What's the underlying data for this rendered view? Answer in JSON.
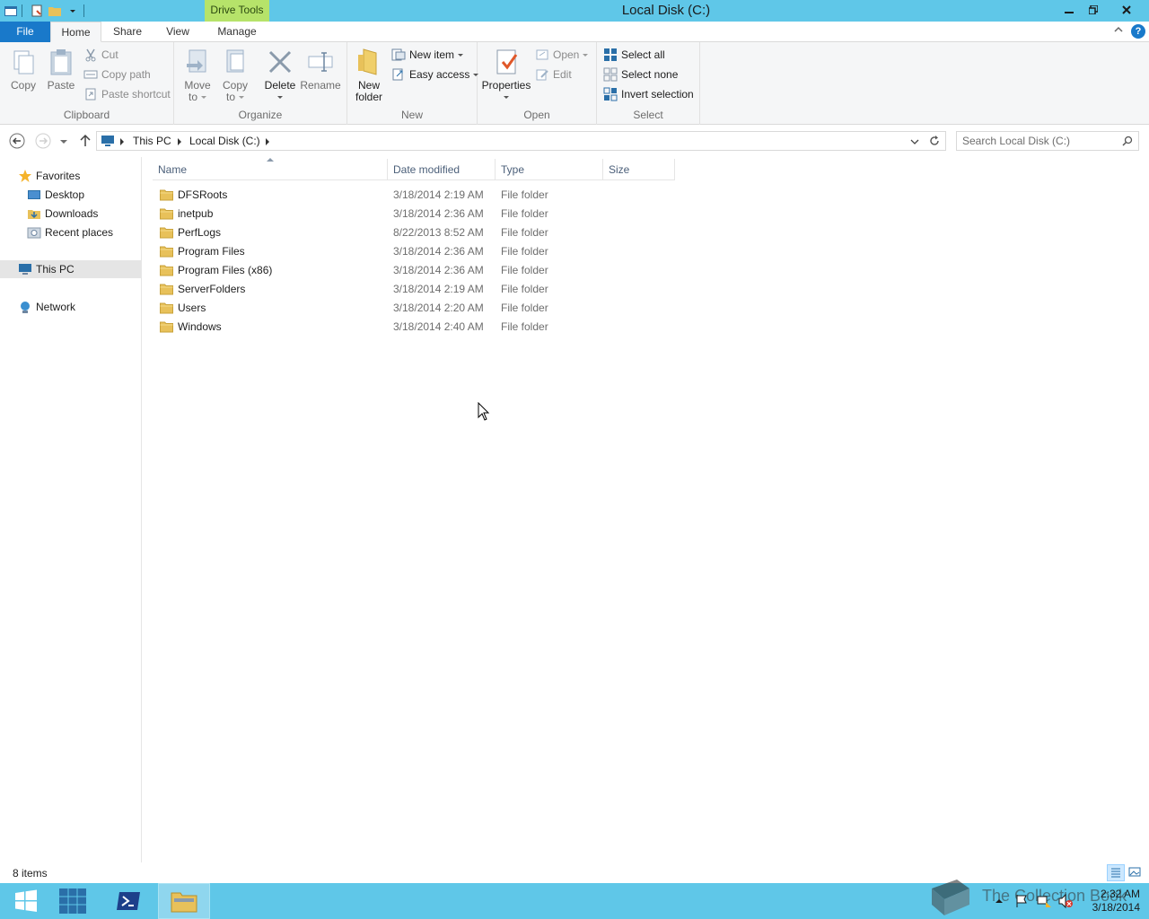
{
  "window": {
    "title": "Local Disk (C:)",
    "contextual_group": "Drive Tools"
  },
  "ribbon_tabs": {
    "file": "File",
    "home": "Home",
    "share": "Share",
    "view": "View",
    "manage": "Manage",
    "help": "?"
  },
  "ribbon": {
    "clipboard": {
      "label": "Clipboard",
      "copy": "Copy",
      "paste": "Paste",
      "cut": "Cut",
      "copy_path": "Copy path",
      "paste_shortcut": "Paste shortcut"
    },
    "organize": {
      "label": "Organize",
      "move_to_1": "Move",
      "move_to_2": "to",
      "copy_to_1": "Copy",
      "copy_to_2": "to",
      "delete": "Delete",
      "rename": "Rename"
    },
    "new": {
      "label": "New",
      "new_folder_1": "New",
      "new_folder_2": "folder",
      "new_item": "New item",
      "easy_access": "Easy access"
    },
    "open": {
      "label": "Open",
      "properties": "Properties",
      "open": "Open",
      "edit": "Edit"
    },
    "select": {
      "label": "Select",
      "select_all": "Select all",
      "select_none": "Select none",
      "invert_selection": "Invert selection"
    }
  },
  "address": {
    "crumbs": [
      "This PC",
      "Local Disk (C:)"
    ],
    "search_placeholder": "Search Local Disk (C:)"
  },
  "nav": {
    "favorites": "Favorites",
    "desktop": "Desktop",
    "downloads": "Downloads",
    "recent_places": "Recent places",
    "this_pc": "This PC",
    "network": "Network"
  },
  "columns": {
    "name": "Name",
    "date_modified": "Date modified",
    "type": "Type",
    "size": "Size"
  },
  "files": [
    {
      "name": "DFSRoots",
      "date": "3/18/2014 2:19 AM",
      "type": "File folder"
    },
    {
      "name": "inetpub",
      "date": "3/18/2014 2:36 AM",
      "type": "File folder"
    },
    {
      "name": "PerfLogs",
      "date": "8/22/2013 8:52 AM",
      "type": "File folder"
    },
    {
      "name": "Program Files",
      "date": "3/18/2014 2:36 AM",
      "type": "File folder"
    },
    {
      "name": "Program Files (x86)",
      "date": "3/18/2014 2:36 AM",
      "type": "File folder"
    },
    {
      "name": "ServerFolders",
      "date": "3/18/2014 2:19 AM",
      "type": "File folder"
    },
    {
      "name": "Users",
      "date": "3/18/2014 2:20 AM",
      "type": "File folder"
    },
    {
      "name": "Windows",
      "date": "3/18/2014 2:40 AM",
      "type": "File folder"
    }
  ],
  "status": {
    "items": "8 items"
  },
  "taskbar": {
    "time": "2:32 AM",
    "date": "3/18/2014",
    "watermark": "The Collection Book"
  },
  "colors": {
    "titlebar": "#5fc7e8",
    "file_tab": "#1979ca",
    "drive_tools": "#b6e36a",
    "folder": "#e8c15a"
  }
}
